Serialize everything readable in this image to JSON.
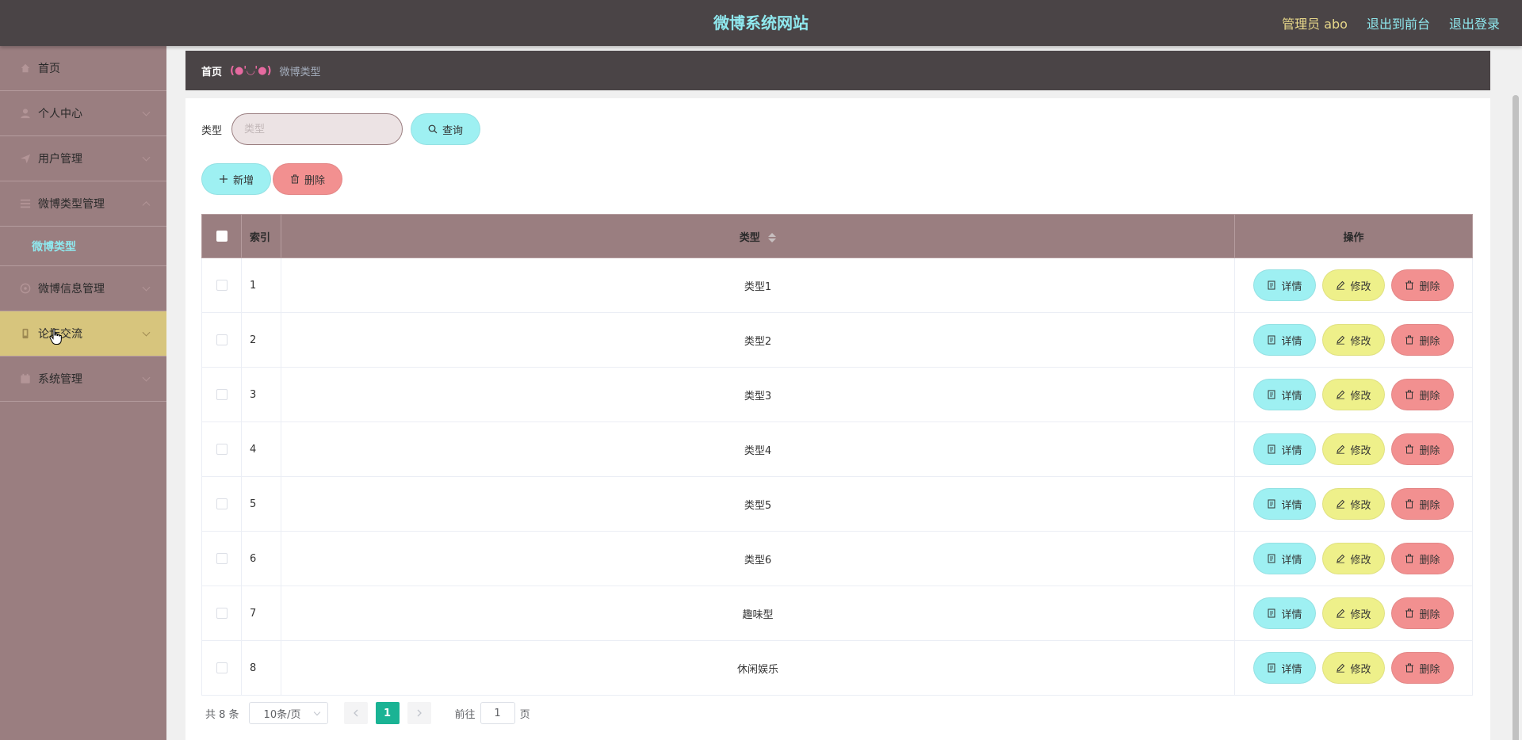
{
  "header": {
    "title": "微博系统网站",
    "admin": "管理员 abo",
    "to_front": "退出到前台",
    "logout": "退出登录"
  },
  "sidebar": {
    "items": [
      {
        "label": "首页"
      },
      {
        "label": "个人中心"
      },
      {
        "label": "用户管理"
      },
      {
        "label": "微博类型管理"
      },
      {
        "label": "微博信息管理"
      },
      {
        "label": "论坛交流"
      },
      {
        "label": "系统管理"
      }
    ],
    "sub_item": "微博类型"
  },
  "breadcrumb": {
    "home": "首页",
    "separator": "(●'◡'●)",
    "current": "微博类型"
  },
  "search": {
    "label": "类型",
    "placeholder": "类型",
    "button": "查询"
  },
  "actions": {
    "add": "新增",
    "delete": "删除"
  },
  "table": {
    "headers": {
      "index": "索引",
      "type": "类型",
      "ops": "操作"
    },
    "rows": [
      {
        "index": "1",
        "type": "类型1"
      },
      {
        "index": "2",
        "type": "类型2"
      },
      {
        "index": "3",
        "type": "类型3"
      },
      {
        "index": "4",
        "type": "类型4"
      },
      {
        "index": "5",
        "type": "类型5"
      },
      {
        "index": "6",
        "type": "类型6"
      },
      {
        "index": "7",
        "type": "趣味型"
      },
      {
        "index": "8",
        "type": "休闲娱乐"
      }
    ],
    "btn_detail": "详情",
    "btn_edit": "修改",
    "btn_delete": "删除"
  },
  "pagination": {
    "total": "共 8 条",
    "page_size": "10条/页",
    "current": "1",
    "goto": "前往",
    "page_value": "1",
    "page_suffix": "页"
  },
  "colors": {
    "header_bg": "#4a4446",
    "sidebar_bg": "#9a7e80",
    "accent_cyan": "#9ef0f2",
    "accent_red": "#f29090",
    "accent_yellow": "#eef08a",
    "active_menu": "#d7c57d",
    "page_active": "#1ab394"
  }
}
